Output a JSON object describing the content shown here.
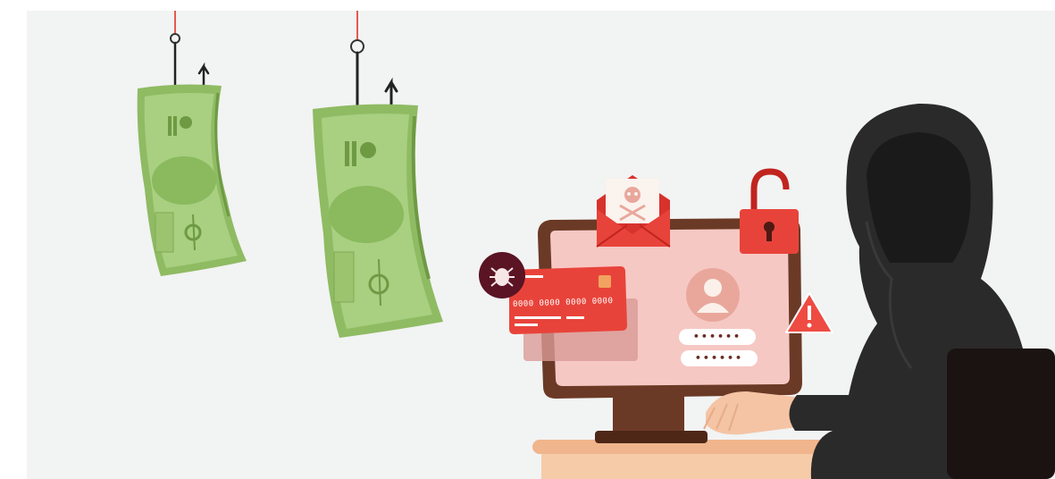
{
  "scene": {
    "description_free": true,
    "colors": {
      "background": "#f2f3f3",
      "money_green": "#9cc46f",
      "money_dark": "#6e9a44",
      "monitor_frame": "#6b3a26",
      "screen": "#f6c8c3",
      "alert_red": "#e8433a",
      "hacker": "#2b2a2a"
    }
  },
  "credit_card": {
    "number": "0000 0000 0000 0000"
  },
  "login_form": {
    "username_mask": "••••••",
    "password_mask": "••••••"
  },
  "icons": [
    "fishing-hook-icon",
    "banknote-icon",
    "phishing-email-icon",
    "skull-icon",
    "unlocked-padlock-icon",
    "warning-triangle-icon",
    "user-avatar-icon",
    "virus-bug-icon",
    "credit-card-icon"
  ]
}
